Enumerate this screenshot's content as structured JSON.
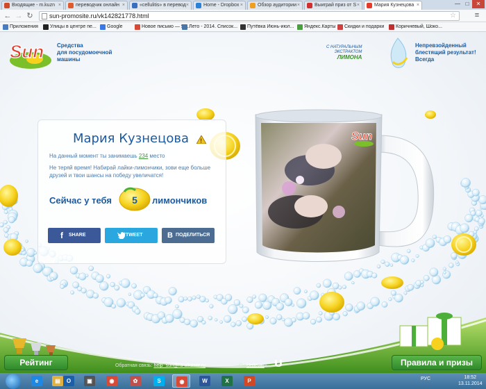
{
  "browser": {
    "tabs": [
      {
        "label": "Входящие - m.kuzn",
        "active": false,
        "favicon": "#d04a2a"
      },
      {
        "label": "переводчик онлайн",
        "active": false,
        "favicon": "#e05a2a"
      },
      {
        "label": "«cellulitis» в перевод",
        "active": false,
        "favicon": "#3a6fc0"
      },
      {
        "label": "Home - Dropbox",
        "active": false,
        "favicon": "#2a82d8"
      },
      {
        "label": "Обзор аудитории",
        "active": false,
        "favicon": "#f0a020"
      },
      {
        "label": "Выиграй приз от S",
        "active": false,
        "favicon": "#d03030"
      },
      {
        "label": "Мария Кузнецова",
        "active": true,
        "favicon": "#e43b2a"
      }
    ],
    "url": "sun-promosite.ru/vk142821778.html",
    "window_controls": [
      "—",
      "□",
      "✕"
    ],
    "bookmarks": [
      {
        "label": "Приложения",
        "icon_color": "#4a7cc0"
      },
      {
        "label": "Улицы в центре пе...",
        "icon_color": "#222222"
      },
      {
        "label": "Google",
        "icon_color": "#3b78e7"
      },
      {
        "label": "Новое письмо — Я...",
        "icon_color": "#d84a38"
      },
      {
        "label": "Лето - 2014. Список...",
        "icon_color": "#4a76a8"
      },
      {
        "label": "Путёвка Июнь-июл...",
        "icon_color": "#333333"
      },
      {
        "label": "Яндекс.Карты",
        "icon_color": "#4aa040"
      },
      {
        "label": "Скидки и подарки",
        "icon_color": "#d04040"
      },
      {
        "label": "Коричневый, Шоко...",
        "icon_color": "#c03030"
      }
    ]
  },
  "page": {
    "brand": "Sun",
    "tagline_left": [
      "Средства",
      "для посудомоечной",
      "машины"
    ],
    "tagline_right": [
      "Непревзойденный",
      "блестящий результат!",
      "Всегда"
    ],
    "badge": [
      "С НАТУРАЛЬНЫМ",
      "ЭКСТРАКТОМ",
      "ЛИМОНА"
    ],
    "user_name": "Мария Кузнецова",
    "rank_prefix": "На данный момент ты занимаешь ",
    "rank_value": "234",
    "rank_suffix": " место",
    "hint": "Не теряй время! Набирай лайки-лимончики, зови еще больше друзей и твои шансы на победу увеличатся!",
    "now_label": "Сейчас у тебя",
    "lemon_count": "5",
    "lemon_unit": "лимончиков",
    "share_buttons": [
      {
        "label": "SHARE",
        "icon": "f",
        "color": "#3b5998"
      },
      {
        "label": "TWEET",
        "icon": "🐦",
        "color": "#2aa7df"
      },
      {
        "label": "ПОДЕЛИТЬСЯ",
        "icon": "B",
        "color": "#4c6c91"
      }
    ],
    "rating_button": "Рейтинг",
    "rules_button": "Правила и призы",
    "feedback_prefix": "Обратная связь: ",
    "feedback_email": "help_sun@ra-alkasar.ru",
    "copyright_prefix": "© «",
    "copyright_link": "Unilever",
    "copyright_suffix": "»"
  },
  "taskbar": {
    "apps": [
      {
        "name": "ie-icon",
        "glyph": "e",
        "color": "#1e88e5",
        "active": false
      },
      {
        "name": "explorer-icon",
        "glyph": "▤",
        "color": "#e0b040",
        "active": false
      },
      {
        "name": "outlook-icon",
        "glyph": "O",
        "color": "#1a5fa8",
        "active": false
      },
      {
        "name": "screenshot-icon",
        "glyph": "▣",
        "color": "#555555",
        "active": false
      },
      {
        "name": "chrome-icon",
        "glyph": "◉",
        "color": "#d84a38",
        "active": false
      },
      {
        "name": "photos-icon",
        "glyph": "✿",
        "color": "#c0504d",
        "active": false
      },
      {
        "name": "skype-icon",
        "glyph": "S",
        "color": "#00aff0",
        "active": false
      },
      {
        "name": "chrome-active-icon",
        "glyph": "◉",
        "color": "#d84a38",
        "active": true
      },
      {
        "name": "word-icon",
        "glyph": "W",
        "color": "#2b579a",
        "active": false
      },
      {
        "name": "excel-icon",
        "glyph": "X",
        "color": "#217346",
        "active": false
      },
      {
        "name": "powerpoint-icon",
        "glyph": "P",
        "color": "#d24726",
        "active": false
      }
    ],
    "lang": "РУС",
    "time": "18:52",
    "date": "13.11.2014"
  }
}
